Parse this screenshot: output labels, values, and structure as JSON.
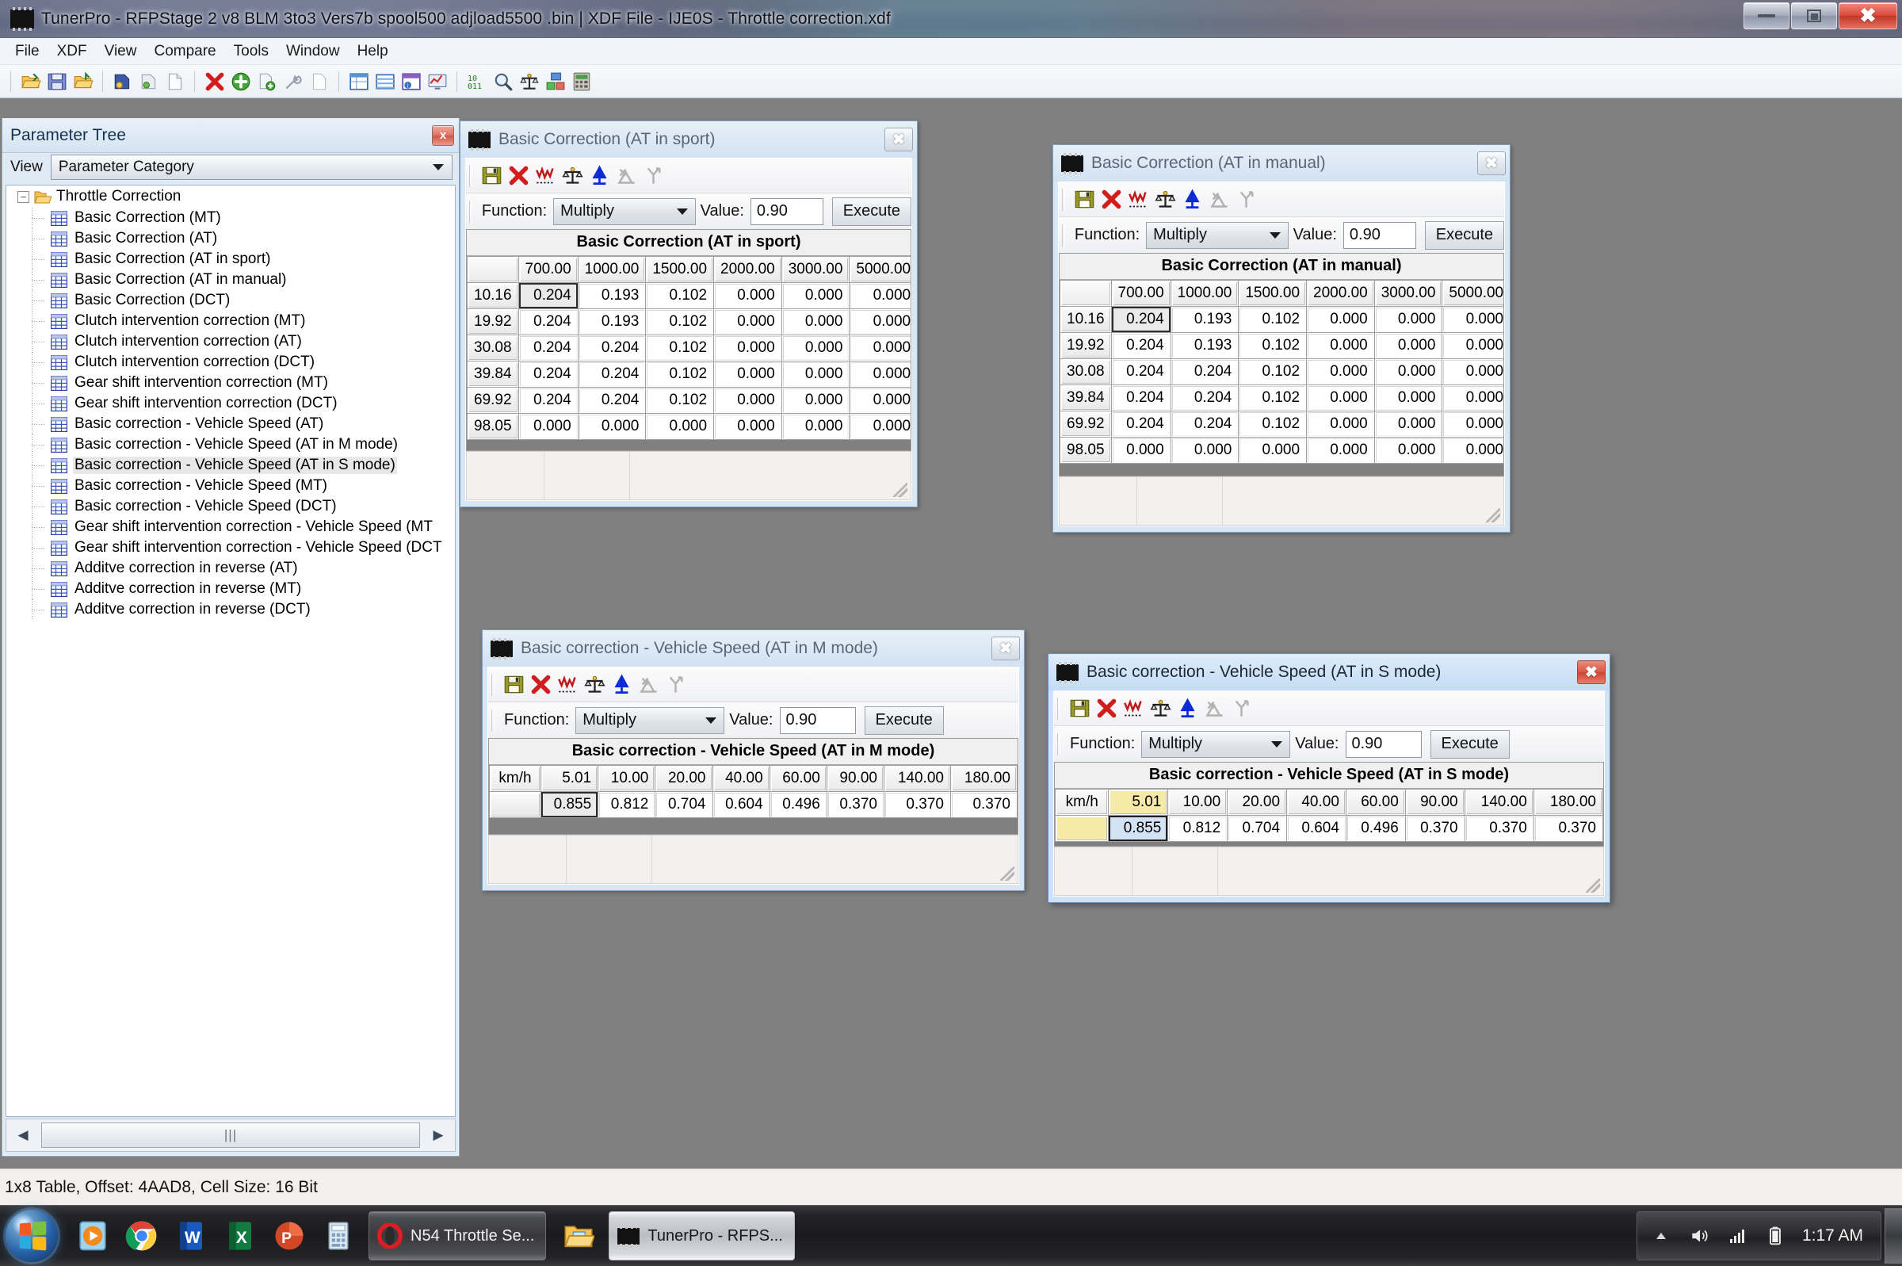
{
  "window": {
    "title": "TunerPro - RFPStage 2 v8 BLM 3to3 Vers7b spool500 adjload5500 .bin | XDF File - IJE0S - Throttle correction.xdf",
    "minimize_label": "Minimize",
    "maximize_label": "Restore",
    "close_label": "Close"
  },
  "menubar": {
    "items": [
      {
        "label": "File"
      },
      {
        "label": "XDF"
      },
      {
        "label": "View"
      },
      {
        "label": "Compare"
      },
      {
        "label": "Tools"
      },
      {
        "label": "Window"
      },
      {
        "label": "Help"
      }
    ]
  },
  "toolbar": {
    "groups": [
      [
        "open-bin-icon",
        "save-bin-icon",
        "open-xdf-icon"
      ],
      [
        "acquire-icon",
        "emulate-icon",
        "new-doc-icon"
      ],
      [
        "delete-icon",
        "add-icon",
        "copy-icon",
        "properties-icon",
        "blank-doc-icon"
      ],
      [
        "table-view-icon",
        "list-view-icon",
        "info-view-icon",
        "graph-view-icon"
      ],
      [
        "hex-icon",
        "search-icon",
        "compare-icon",
        "layout-icon",
        "calculator-icon"
      ]
    ]
  },
  "parameter_tree": {
    "panel_title": "Parameter Tree",
    "close_label": "x",
    "view_label": "View",
    "category_value": "Parameter Category",
    "root": "Throttle Correction",
    "expander": "−",
    "items": [
      {
        "label": "Basic Correction (MT)",
        "selected": false
      },
      {
        "label": "Basic Correction (AT)",
        "selected": false
      },
      {
        "label": "Basic Correction (AT in sport)",
        "selected": false
      },
      {
        "label": "Basic Correction (AT in manual)",
        "selected": false
      },
      {
        "label": "Basic Correction (DCT)",
        "selected": false
      },
      {
        "label": "Clutch intervention correction (MT)",
        "selected": false
      },
      {
        "label": "Clutch intervention correction (AT)",
        "selected": false
      },
      {
        "label": "Clutch intervention correction (DCT)",
        "selected": false
      },
      {
        "label": "Gear shift intervention correction (MT)",
        "selected": false
      },
      {
        "label": "Gear shift intervention correction (DCT)",
        "selected": false
      },
      {
        "label": "Basic correction - Vehicle Speed (AT)",
        "selected": false
      },
      {
        "label": "Basic correction - Vehicle Speed (AT in M mode)",
        "selected": false
      },
      {
        "label": "Basic correction - Vehicle Speed (AT in S mode)",
        "selected": true
      },
      {
        "label": "Basic correction - Vehicle Speed (MT)",
        "selected": false
      },
      {
        "label": "Basic correction - Vehicle Speed (DCT)",
        "selected": false
      },
      {
        "label": "Gear shift intervention correction - Vehicle Speed (MT",
        "selected": false
      },
      {
        "label": "Gear shift intervention correction - Vehicle Speed (DCT",
        "selected": false
      },
      {
        "label": "Additve correction in reverse (AT)",
        "selected": false
      },
      {
        "label": "Additve correction in reverse (MT)",
        "selected": false
      },
      {
        "label": "Additve correction in reverse (DCT)",
        "selected": false
      }
    ],
    "scroll_left_label": "◀",
    "scroll_right_label": "▶",
    "scroll_thumb_label": "|||"
  },
  "child_toolbar": {
    "icons": [
      "save-table-icon",
      "revert-icon",
      "graph-icon",
      "compare-icon",
      "scale-icon",
      "interpolate-icon",
      "split-icon"
    ],
    "function_label": "Function:",
    "function_value": "Multiply",
    "value_label": "Value:",
    "value_value": "0.90",
    "execute_label": "Execute"
  },
  "windows": [
    {
      "id": "at-in-sport",
      "title": "Basic Correction (AT in sport)",
      "caption": "Basic Correction (AT in sport)",
      "active": false,
      "close_label": "✖",
      "table": {
        "corner": "",
        "columns": [
          "700.00",
          "1000.00",
          "1500.00",
          "2000.00",
          "3000.00",
          "5000.00"
        ],
        "rows": [
          "10.16",
          "19.92",
          "30.08",
          "39.84",
          "69.92",
          "98.05"
        ],
        "values": [
          [
            "0.204",
            "0.193",
            "0.102",
            "0.000",
            "0.000",
            "0.000"
          ],
          [
            "0.204",
            "0.193",
            "0.102",
            "0.000",
            "0.000",
            "0.000"
          ],
          [
            "0.204",
            "0.204",
            "0.102",
            "0.000",
            "0.000",
            "0.000"
          ],
          [
            "0.204",
            "0.204",
            "0.102",
            "0.000",
            "0.000",
            "0.000"
          ],
          [
            "0.204",
            "0.204",
            "0.102",
            "0.000",
            "0.000",
            "0.000"
          ],
          [
            "0.000",
            "0.000",
            "0.000",
            "0.000",
            "0.000",
            "0.000"
          ]
        ],
        "cursor": [
          0,
          0
        ]
      }
    },
    {
      "id": "at-in-manual",
      "title": "Basic Correction (AT in manual)",
      "caption": "Basic Correction (AT in manual)",
      "active": false,
      "close_label": "✖",
      "table": {
        "corner": "",
        "columns": [
          "700.00",
          "1000.00",
          "1500.00",
          "2000.00",
          "3000.00",
          "5000.00"
        ],
        "rows": [
          "10.16",
          "19.92",
          "30.08",
          "39.84",
          "69.92",
          "98.05"
        ],
        "values": [
          [
            "0.204",
            "0.193",
            "0.102",
            "0.000",
            "0.000",
            "0.000"
          ],
          [
            "0.204",
            "0.193",
            "0.102",
            "0.000",
            "0.000",
            "0.000"
          ],
          [
            "0.204",
            "0.204",
            "0.102",
            "0.000",
            "0.000",
            "0.000"
          ],
          [
            "0.204",
            "0.204",
            "0.102",
            "0.000",
            "0.000",
            "0.000"
          ],
          [
            "0.204",
            "0.204",
            "0.102",
            "0.000",
            "0.000",
            "0.000"
          ],
          [
            "0.000",
            "0.000",
            "0.000",
            "0.000",
            "0.000",
            "0.000"
          ]
        ],
        "cursor": [
          0,
          0
        ]
      }
    },
    {
      "id": "speed-m-mode",
      "title": "Basic correction - Vehicle Speed (AT in M mode)",
      "caption": "Basic correction - Vehicle Speed (AT in M mode)",
      "active": false,
      "close_label": "✖",
      "table": {
        "corner": "km/h",
        "columns": [
          "5.01",
          "10.00",
          "20.00",
          "40.00",
          "60.00",
          "90.00",
          "140.00",
          "180.00"
        ],
        "rows": [
          ""
        ],
        "values": [
          [
            "0.855",
            "0.812",
            "0.704",
            "0.604",
            "0.496",
            "0.370",
            "0.370",
            "0.370"
          ]
        ],
        "cursor": [
          0,
          0
        ]
      }
    },
    {
      "id": "speed-s-mode",
      "title": "Basic correction - Vehicle Speed (AT in S mode)",
      "caption": "Basic correction - Vehicle Speed (AT in S mode)",
      "active": true,
      "close_label": "✖",
      "table": {
        "corner": "km/h",
        "columns": [
          "5.01",
          "10.00",
          "20.00",
          "40.00",
          "60.00",
          "90.00",
          "140.00",
          "180.00"
        ],
        "rows": [
          ""
        ],
        "values": [
          [
            "0.855",
            "0.812",
            "0.704",
            "0.604",
            "0.496",
            "0.370",
            "0.370",
            "0.370"
          ]
        ],
        "cursor": [
          0,
          0
        ],
        "highlight_header": 0,
        "highlight_rowhdr": true
      }
    }
  ],
  "statusbar": {
    "text": "1x8 Table, Offset: 4AAD8,  Cell Size: 16 Bit"
  },
  "taskbar": {
    "start_label": "Start",
    "quick_icons": [
      {
        "name": "media-player-icon"
      },
      {
        "name": "chrome-icon"
      },
      {
        "name": "word-icon"
      },
      {
        "name": "excel-icon"
      },
      {
        "name": "powerpoint-icon"
      },
      {
        "name": "calculator-icon"
      }
    ],
    "buttons": [
      {
        "label": "N54 Throttle Se...",
        "icon": "opera-icon",
        "active": false
      },
      {
        "label": "",
        "icon": "folder-icon",
        "active": false
      },
      {
        "label": "TunerPro - RFPS...",
        "icon": "tunerpro-icon",
        "active": true
      }
    ],
    "tray": {
      "show_hidden": "▲",
      "volume": "volume-icon",
      "network": "network-icon",
      "battery": "battery-icon",
      "time": "1:17 AM"
    }
  },
  "colors": {
    "mdi_background": "#808080",
    "active_accent": "#cd4433",
    "highlight_cell": "#f7e9a8",
    "cursor_cell": "#d3e3f5"
  }
}
